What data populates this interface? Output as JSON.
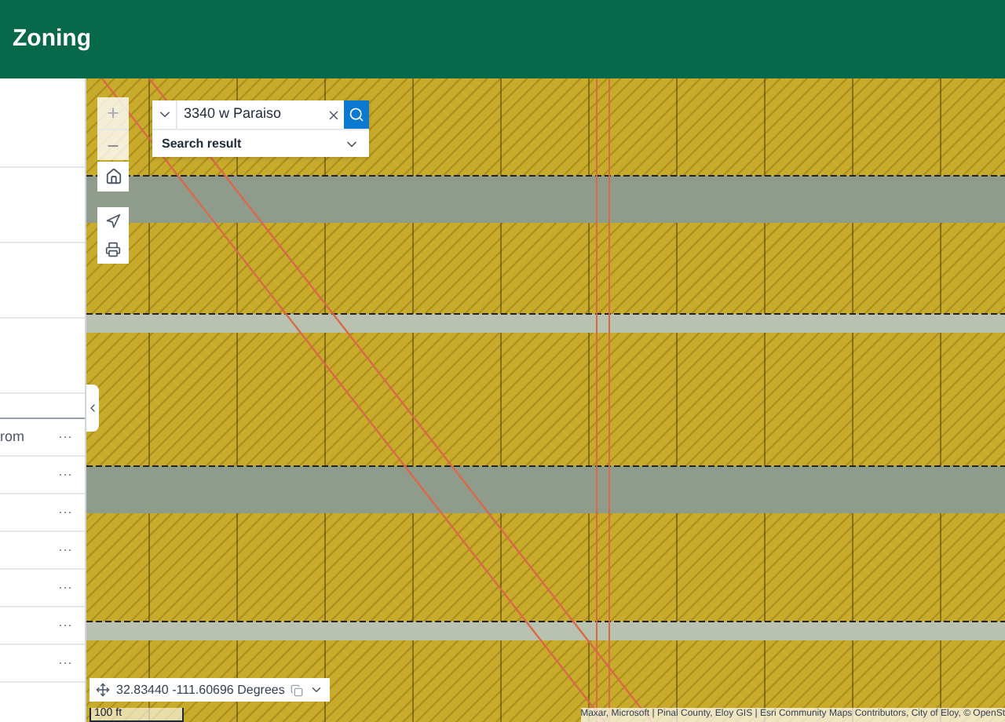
{
  "header": {
    "title": "Zoning"
  },
  "search": {
    "value": "3340 w Paraiso",
    "result_label": "Search result"
  },
  "panel_rows": [
    {
      "label": "rom",
      "menu": "···"
    },
    {
      "menu": "···"
    },
    {
      "menu": "···"
    },
    {
      "menu": "···"
    },
    {
      "menu": "···"
    },
    {
      "menu": "···"
    },
    {
      "menu": "···"
    }
  ],
  "coordinates": {
    "value": "32.83440 -111.60696 Degrees"
  },
  "scale": {
    "label": "100 ft"
  },
  "attribution": "Maxar, Microsoft | Pinal County, Eloy GIS | Esri Community Maps Contributors, City of Eloy, © OpenSt"
}
